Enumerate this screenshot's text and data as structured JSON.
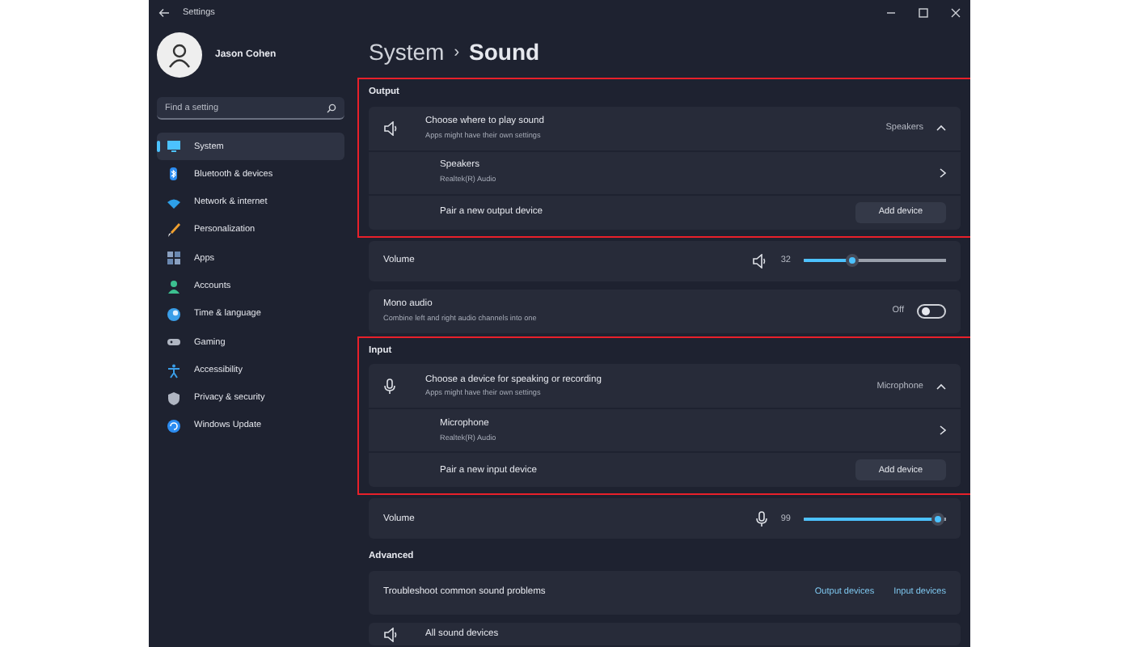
{
  "window": {
    "title": "Settings"
  },
  "user": {
    "name": "Jason Cohen"
  },
  "search": {
    "placeholder": "Find a setting"
  },
  "sidebar": {
    "items": [
      {
        "label": "System",
        "kind": "display",
        "selected": true
      },
      {
        "label": "Bluetooth & devices",
        "kind": "bluetooth",
        "selected": false
      },
      {
        "label": "Network & internet",
        "kind": "wifi",
        "selected": false
      },
      {
        "label": "Personalization",
        "kind": "brush",
        "selected": false
      },
      {
        "label": "Apps",
        "kind": "apps",
        "selected": false
      },
      {
        "label": "Accounts",
        "kind": "person",
        "selected": false
      },
      {
        "label": "Time & language",
        "kind": "globe",
        "selected": false
      },
      {
        "label": "Gaming",
        "kind": "gamepad",
        "selected": false
      },
      {
        "label": "Accessibility",
        "kind": "accessibility",
        "selected": false
      },
      {
        "label": "Privacy & security",
        "kind": "shield",
        "selected": false
      },
      {
        "label": "Windows Update",
        "kind": "update",
        "selected": false
      }
    ]
  },
  "breadcrumb": {
    "parent": "System",
    "separator": "›",
    "current": "Sound"
  },
  "panels": [
    {
      "heading": "Output",
      "highlighted": true,
      "rows": [
        {
          "kind": "chooser",
          "title": "Choose where to play sound",
          "subtitle": "Apps might have their own settings",
          "value": "Speakers",
          "expanded": true
        },
        {
          "kind": "device",
          "title": "Speakers",
          "subtitle": "Realtek(R) Audio"
        },
        {
          "kind": "pair",
          "title": "Pair a new output device",
          "button": "Add device"
        }
      ]
    },
    {
      "rows": [
        {
          "kind": "volume",
          "title": "Volume",
          "reading": "32",
          "level": 0.32
        }
      ]
    },
    {
      "rows": [
        {
          "kind": "toggle",
          "title": "Mono audio",
          "subtitle": "Combine left and right audio channels into one",
          "state_label": "Off",
          "on": false
        }
      ]
    },
    {
      "heading": "Input",
      "highlighted": true,
      "rows": [
        {
          "kind": "chooser",
          "title": "Choose a device for speaking or recording",
          "subtitle": "Apps might have their own settings",
          "value": "Microphone",
          "expanded": true
        },
        {
          "kind": "device",
          "title": "Microphone",
          "subtitle": "Realtek(R) Audio"
        },
        {
          "kind": "pair",
          "title": "Pair a new input device",
          "button": "Add device"
        }
      ]
    },
    {
      "rows": [
        {
          "kind": "volume",
          "title": "Volume",
          "reading": "99",
          "level": 0.99
        }
      ]
    },
    {
      "heading": "Advanced",
      "rows": [
        {
          "kind": "links",
          "title": "Troubleshoot common sound problems",
          "links": [
            "Output devices",
            "Input devices"
          ]
        }
      ]
    },
    {
      "rows": [
        {
          "kind": "group",
          "title": "All sound devices"
        }
      ]
    }
  ]
}
